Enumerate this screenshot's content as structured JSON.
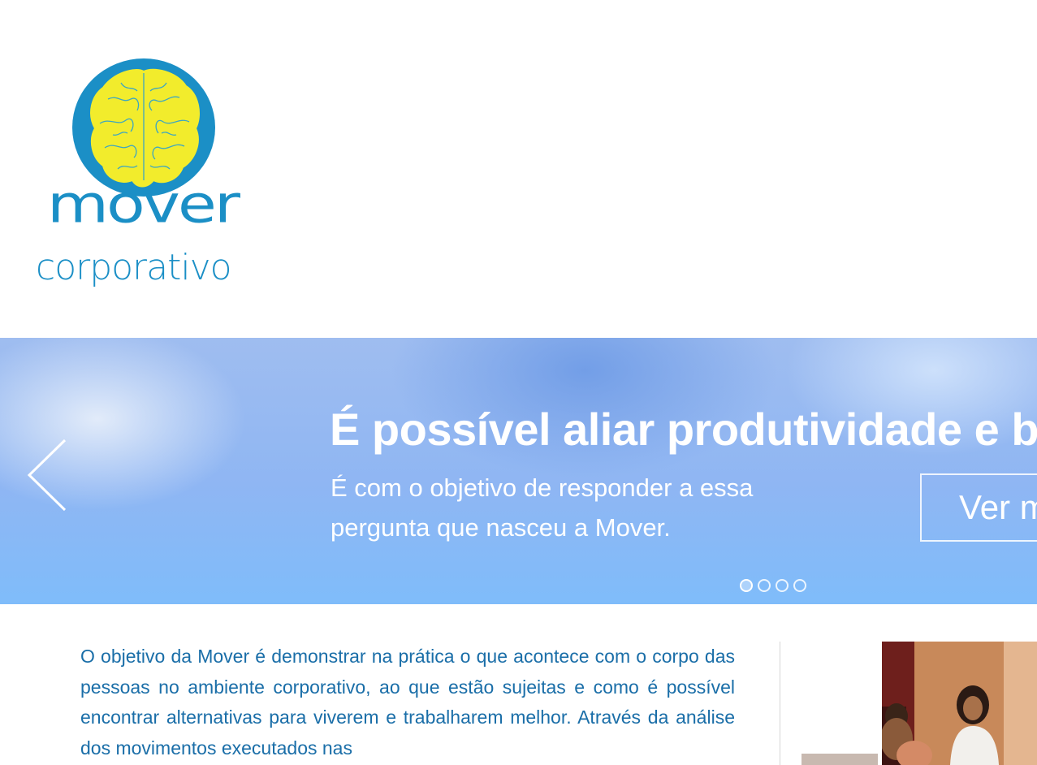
{
  "logo": {
    "word1": "mover",
    "word2": "corporativo"
  },
  "hero": {
    "title": "É possível aliar produtividade e bem-estar?",
    "subtitle": "É com o objetivo de responder a essa pergunta que nasceu a Mover.",
    "button_label": "Ver mais",
    "slides": 4,
    "active_slide": 1
  },
  "content": {
    "paragraph": "O objetivo da Mover é demonstrar na prática o que acontece com o corpo das pessoas no ambiente corporativo, ao que estão sujeitas e como é possível encontrar alternativas para viverem e trabalharem melhor. Através da análise dos movimentos executados nas"
  },
  "colors": {
    "brand_blue": "#1b8fc6",
    "brain_yellow": "#f2ec2c",
    "text_blue": "#1a6ea8"
  }
}
